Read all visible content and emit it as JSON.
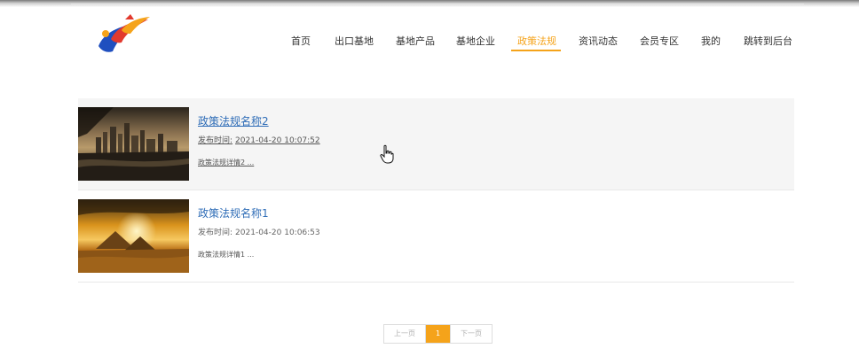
{
  "header": {
    "logo_icon": "brand-logo-icon"
  },
  "nav": {
    "items": [
      {
        "label": "首页"
      },
      {
        "label": "出口基地"
      },
      {
        "label": "基地产品"
      },
      {
        "label": "基地企业"
      },
      {
        "label": "政策法规"
      },
      {
        "label": "资讯动态"
      },
      {
        "label": "会员专区"
      },
      {
        "label": "我的"
      },
      {
        "label": "跳转到后台"
      }
    ],
    "active_index": 4,
    "active_color": "#f5a31a"
  },
  "articles": [
    {
      "title": "政策法规名称2",
      "time_label": "发布时间:",
      "time_value": "2021-04-20 10:07:52",
      "summary": "政策法规详情2 ..."
    },
    {
      "title": "政策法规名称1",
      "time_label": "发布时间:",
      "time_value": "2021-04-20 10:06:53",
      "summary": "政策法规详情1 ..."
    }
  ],
  "pagination": {
    "prev_label": "上一页",
    "current_page": "1",
    "next_label": "下一页"
  },
  "colors": {
    "accent": "#f5a31a",
    "link": "#2f6db7"
  }
}
